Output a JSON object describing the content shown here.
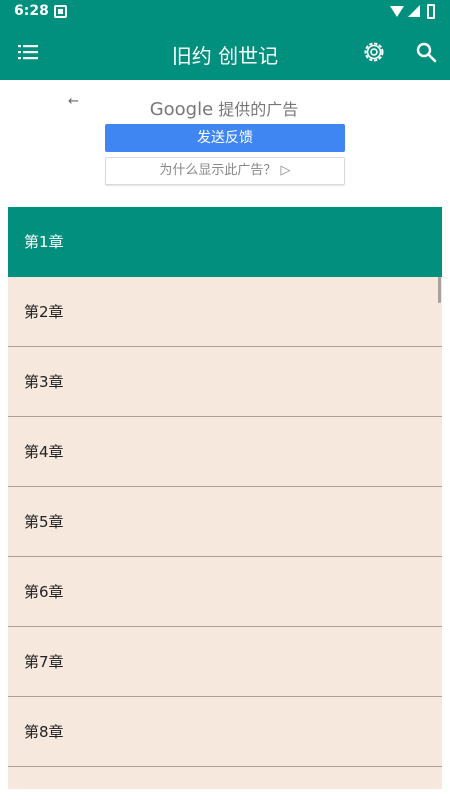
{
  "status_bar": {
    "time": "6:28"
  },
  "app_bar": {
    "title": "旧约 创世记"
  },
  "ad": {
    "google": "Google",
    "provided_text": " 提供的广告",
    "feedback_label": "发送反馈",
    "why_label": "为什么显示此广告？ ▷"
  },
  "chapters": {
    "items": [
      "第1章",
      "第2章",
      "第3章",
      "第4章",
      "第5章",
      "第6章",
      "第7章",
      "第8章"
    ],
    "selected": "第1章"
  },
  "colors": {
    "teal": "#018f7e",
    "row_bg": "#f6e8dc",
    "ad_button": "#3f86f2"
  }
}
